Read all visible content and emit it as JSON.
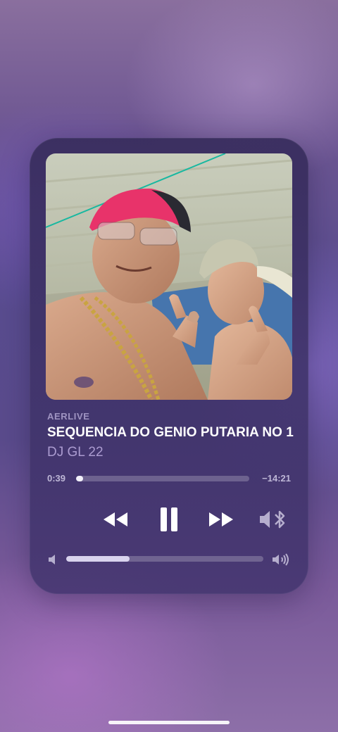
{
  "player": {
    "source": "AERLIVE",
    "title": "SEQUENCIA DO GENIO PUTARIA NO 1",
    "artist": "DJ GL 22",
    "elapsed": "0:39",
    "remaining": "−14:21",
    "progress_fraction": 0.04,
    "volume_fraction": 0.32
  },
  "controls": {
    "rewind_icon": "rewind-icon",
    "pause_icon": "pause-icon",
    "forward_icon": "fast-forward-icon",
    "airplay_icon": "speaker-bluetooth-icon",
    "volume_low_icon": "volume-low-icon",
    "volume_high_icon": "volume-high-icon"
  },
  "colors": {
    "card_background": "#3a2f66",
    "progress_fill": "#f2f0fa",
    "volume_fill": "#d9d3ee"
  }
}
